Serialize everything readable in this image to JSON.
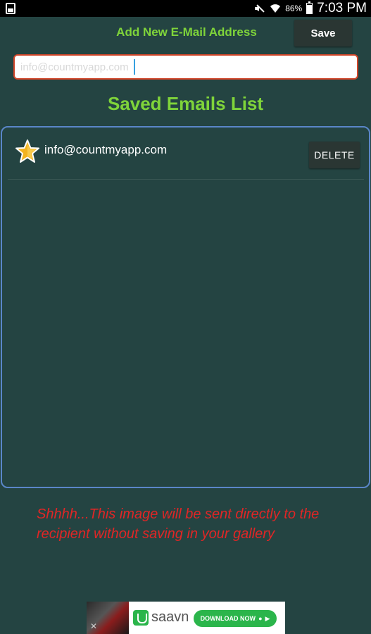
{
  "status_bar": {
    "battery": "86%",
    "time": "7:03 PM"
  },
  "header": {
    "title": "Add New E-Mail Address",
    "save_label": "Save"
  },
  "email_input": {
    "placeholder": "info@countmyapp.com",
    "value": ""
  },
  "saved_list": {
    "title": "Saved Emails List",
    "items": [
      {
        "email": "info@countmyapp.com",
        "delete_label": "DELETE",
        "icon": "star-icon"
      }
    ]
  },
  "warning": "Shhhh...This image will be sent directly to the recipient without saving in your gallery",
  "ad": {
    "brand": "saavn",
    "cta": "DOWNLOAD NOW",
    "close": "✕"
  },
  "colors": {
    "background": "#244442",
    "accent_green": "#7fd43a",
    "warning_red": "#e02626",
    "list_border": "#5a86c8"
  }
}
